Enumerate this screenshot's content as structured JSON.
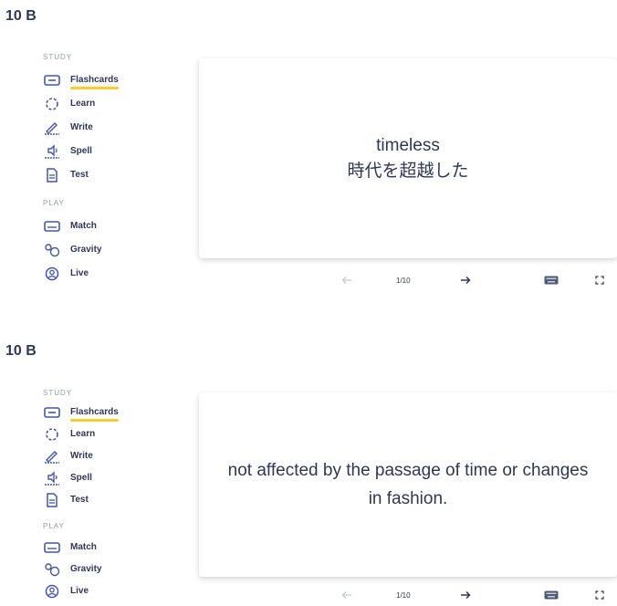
{
  "panels": [
    {
      "title": "10 B",
      "study_label": "STUDY",
      "play_label": "PLAY",
      "study_items": [
        "Flashcards",
        "Learn",
        "Write",
        "Spell",
        "Test"
      ],
      "play_items": [
        "Match",
        "Gravity",
        "Live"
      ],
      "card": {
        "term": "timeless",
        "translation": "時代を超越した"
      },
      "counter": "1/10"
    },
    {
      "title": "10 B",
      "study_label": "STUDY",
      "play_label": "PLAY",
      "study_items": [
        "Flashcards",
        "Learn",
        "Write",
        "Spell",
        "Test"
      ],
      "play_items": [
        "Match",
        "Gravity",
        "Live"
      ],
      "card": {
        "definition": "not affected by the passage of time or changes in fashion."
      },
      "counter": "1/10"
    }
  ],
  "icons": {
    "flashcards": "flashcards-icon",
    "learn": "learn-icon",
    "write": "write-icon",
    "spell": "spell-icon",
    "test": "test-icon",
    "match": "match-icon",
    "gravity": "gravity-icon",
    "live": "live-icon",
    "prev": "arrow-left-icon",
    "next": "arrow-right-icon",
    "keyboard": "keyboard-icon",
    "fullscreen": "fullscreen-icon"
  },
  "colors": {
    "text": "#2e3856",
    "muted": "#939bb4",
    "active_underline": "#ffcd1f",
    "icon_blue": "#4257b2"
  }
}
